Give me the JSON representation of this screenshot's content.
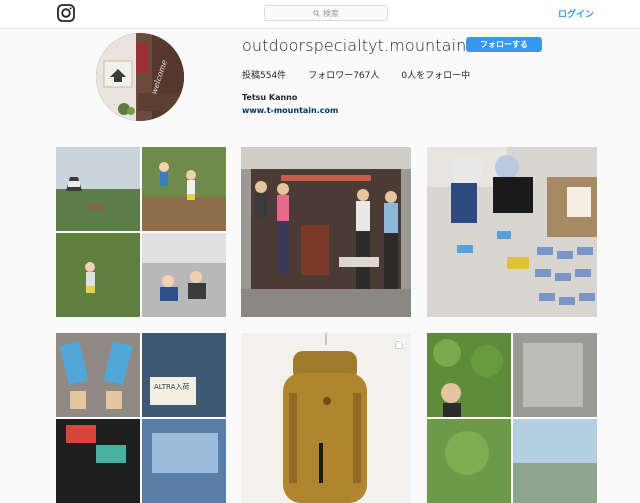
{
  "header": {
    "logo_icon": "instagram-icon",
    "search_placeholder": "検索",
    "search_icon": "search-icon",
    "login_label": "ログイン"
  },
  "profile": {
    "username": "outdoorspecialtyt.mountain",
    "follow_label": "フォローする",
    "follow_color": "#3897f0",
    "stats": {
      "posts": "投稿554件",
      "followers": "フォロワー767人",
      "following": "0人をフォロー中"
    },
    "full_name": "Tetsu Kanno",
    "website": "www.t-mountain.com",
    "avatar_sign": "welcome"
  },
  "posts": [
    {
      "kind": "collage-castle-hiking"
    },
    {
      "kind": "group-in-front-of-shop"
    },
    {
      "kind": "kids-trying-shoes"
    },
    {
      "kind": "collage-trail-shoes",
      "note_text": "ALTRA入荷"
    },
    {
      "kind": "arcteryx-backpack",
      "multi": true
    },
    {
      "kind": "collage-mountain-rocks"
    }
  ]
}
